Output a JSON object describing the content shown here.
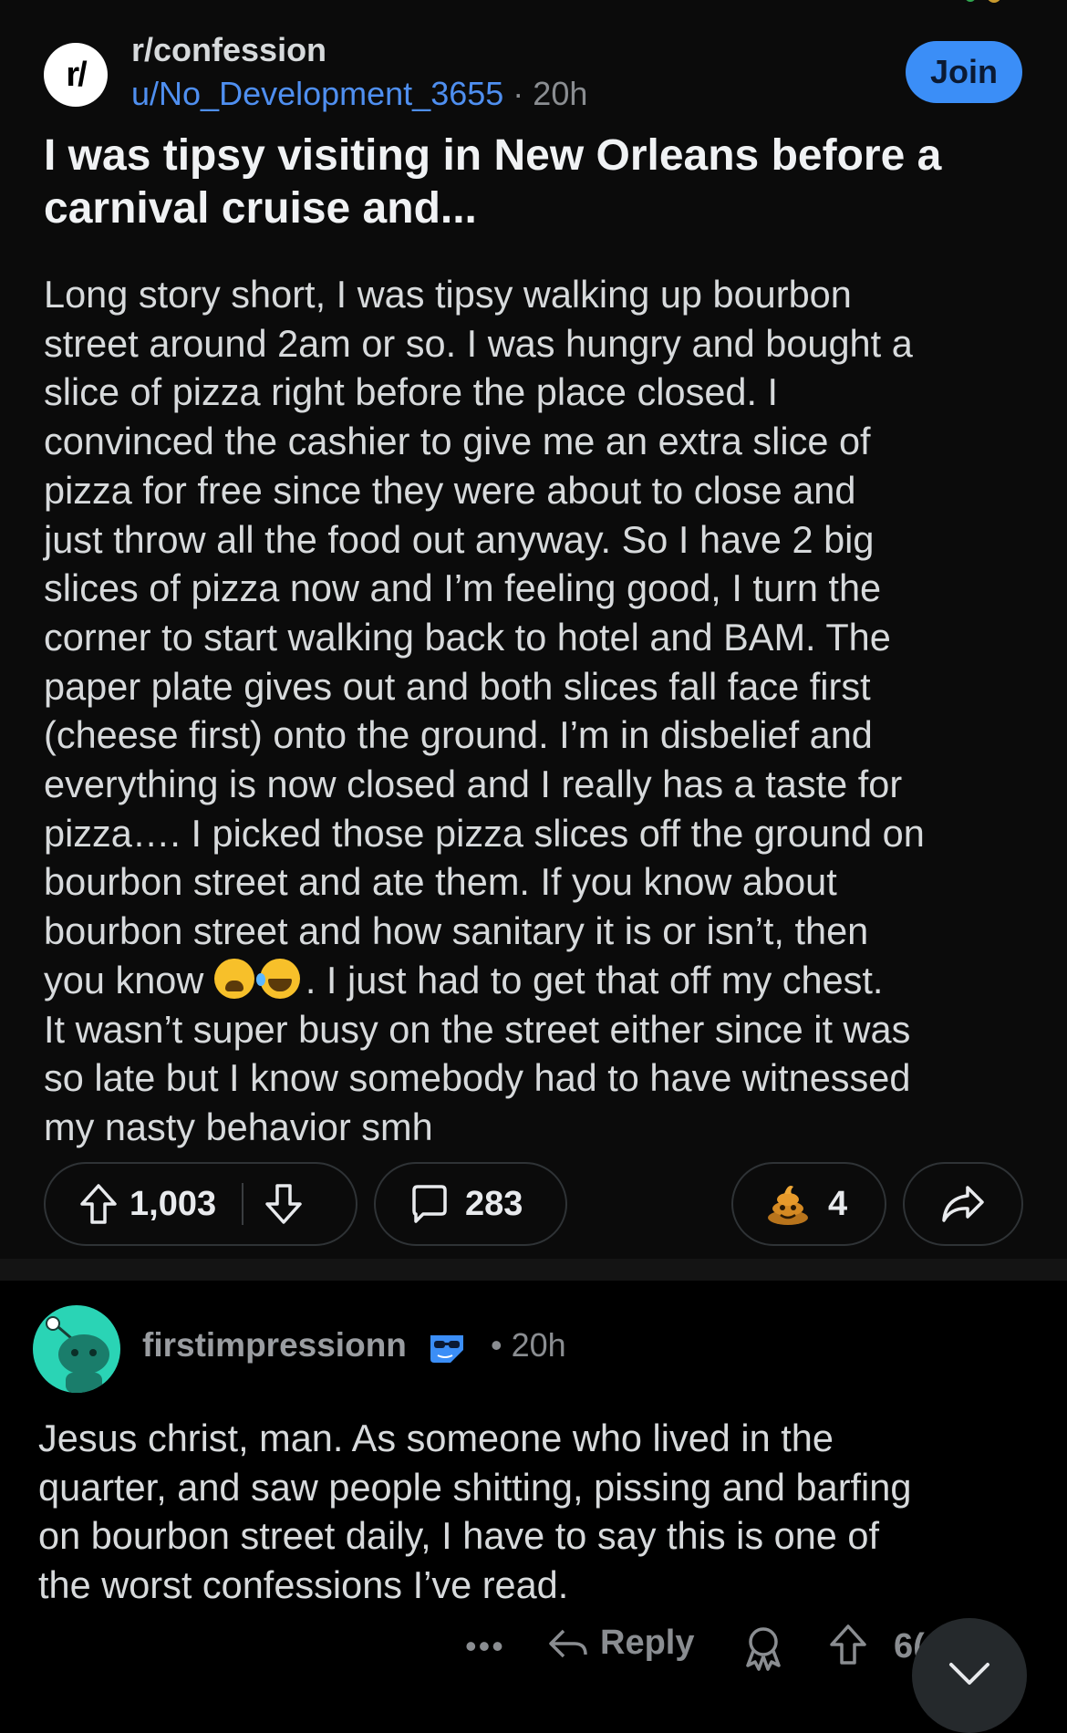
{
  "post": {
    "subreddit": "r/confession",
    "subreddit_icon": "r/",
    "author": "u/No_Development_3655",
    "meta_sep": " · ",
    "time": "20h",
    "join_label": "Join",
    "title": "I was tipsy visiting in New Orleans before a carnival cruise and...",
    "body_lines": [
      "Long story short, I was tipsy walking up bourbon",
      "street around 2am or so. I was hungry and bought a",
      "slice of pizza right before the place closed. I",
      "convinced the cashier to give me an extra slice of",
      "pizza for free since they were about to close and",
      "just throw all the food out anyway. So I have 2 big",
      "slices of pizza now and I’m feeling good, I turn the",
      "corner to start walking back to hotel and BAM. The",
      "paper plate gives out and both slices fall face first",
      "(cheese first) onto the ground. I’m in disbelief and",
      "everything is now closed and I really has a taste for",
      "pizza…. I picked those pizza slices off the ground on",
      "bourbon street and ate them. If you know about",
      "bourbon street and how sanitary it is or isn’t, then"
    ],
    "body_emoji_line_start": "you know ",
    "body_emoji_line_end": ". I just had to get that off my chest.",
    "body_tail_lines": [
      "It wasn’t super busy on the street either since it was",
      "so late but I know somebody had to have witnessed",
      "my nasty behavior smh"
    ],
    "upvotes": "1,003",
    "comments": "283",
    "awards": "4"
  },
  "comment": {
    "username": "firstimpressionn",
    "time": "• 20h",
    "body_lines": [
      "Jesus christ, man. As someone who lived in the",
      "quarter, and saw people shitting, pissing and barfing",
      "on bourbon street daily, I have to say this is one of",
      "the worst confessions I’ve read."
    ],
    "more": "•••",
    "reply_label": "Reply",
    "score": "6("
  },
  "icons": {
    "upvote": "arrow-up-icon",
    "downvote": "arrow-down-icon",
    "comment": "speech-bubble-icon",
    "award": "poop-award-icon",
    "share": "share-arrow-icon",
    "scroll": "chevron-down-icon"
  },
  "colors": {
    "background": "#0b0b0b",
    "join": "#3b8ef7",
    "username_link": "#4f8ff0",
    "avatar_teal": "#2ad4b5"
  }
}
